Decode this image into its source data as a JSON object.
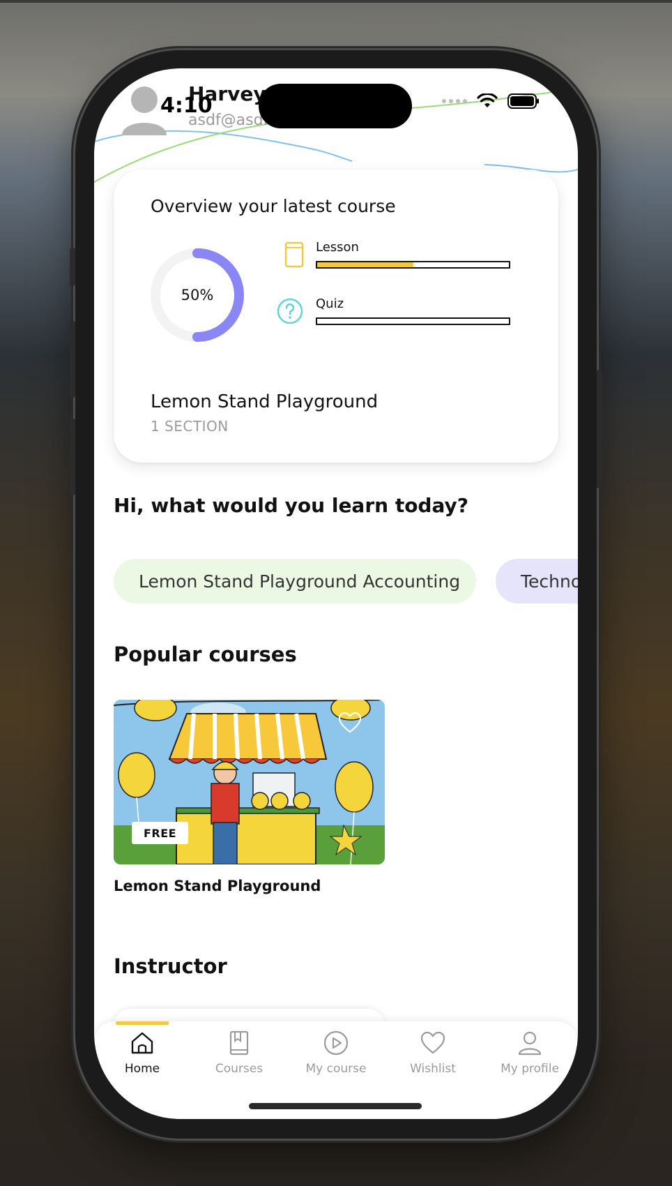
{
  "status_bar": {
    "time": "4:10"
  },
  "header": {
    "user_name": "Harvey",
    "user_email": "asdf@asdf.com"
  },
  "overview": {
    "title": "Overview your latest course",
    "progress_percent": 50,
    "progress_label": "50%",
    "progress_color": "#8b86f5",
    "metrics": [
      {
        "label": "Lesson",
        "icon": "book-icon",
        "progress": 0.5,
        "color": "#f5c842"
      },
      {
        "label": "Quiz",
        "icon": "question-circle-icon",
        "progress": 0.0,
        "color": "#5fd4d4"
      }
    ],
    "course_name": "Lemon Stand Playground",
    "course_sections": "1 SECTION"
  },
  "greeting": "Hi, what would you learn today?",
  "categories": [
    {
      "label": "Lemon Stand Playground Accounting",
      "color": "#ebf9e4"
    },
    {
      "label": "Technology",
      "color": "#e6e4fb"
    }
  ],
  "popular": {
    "title": "Popular courses",
    "courses": [
      {
        "title": "Lemon Stand Playground",
        "badge": "FREE"
      }
    ]
  },
  "instructor": {
    "title": "Instructor"
  },
  "tab_bar": {
    "active_color": "#f5c842",
    "tabs": [
      {
        "label": "Home",
        "icon": "home-icon",
        "active": true
      },
      {
        "label": "Courses",
        "icon": "bookmark-book-icon",
        "active": false
      },
      {
        "label": "My course",
        "icon": "play-circle-icon",
        "active": false
      },
      {
        "label": "Wishlist",
        "icon": "heart-icon",
        "active": false
      },
      {
        "label": "My profile",
        "icon": "user-icon",
        "active": false
      }
    ]
  }
}
